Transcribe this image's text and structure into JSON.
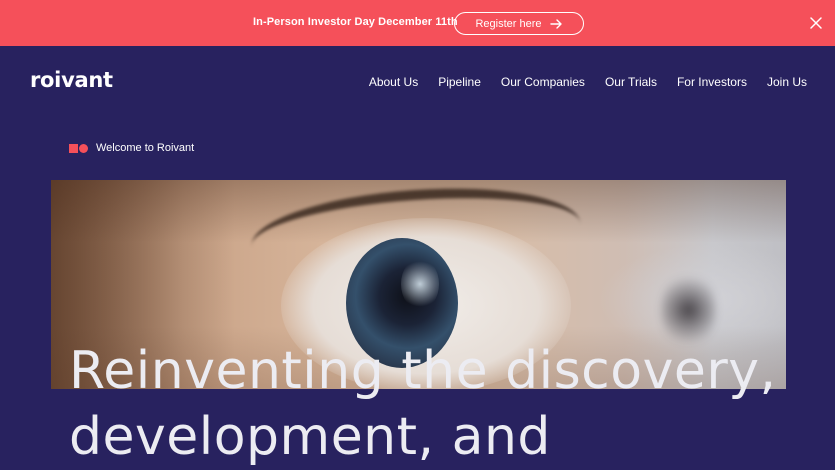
{
  "colors": {
    "accent": "#f5505a",
    "background": "#28225f"
  },
  "announcement": {
    "text": "In-Person Investor Day December 11th",
    "button_label": "Register here",
    "button_icon": "arrow-right-icon",
    "close_icon": "close-icon"
  },
  "header": {
    "logo": "roivant",
    "nav": [
      {
        "label": "About Us"
      },
      {
        "label": "Pipeline"
      },
      {
        "label": "Our Companies"
      },
      {
        "label": "Our Trials"
      },
      {
        "label": "For Investors"
      },
      {
        "label": "Join Us"
      }
    ]
  },
  "hero": {
    "welcome_label": "Welcome to Roivant",
    "image_alt": "eye-photo",
    "headline_line1": "Reinventing the discovery,",
    "headline_line2": "development, and"
  }
}
